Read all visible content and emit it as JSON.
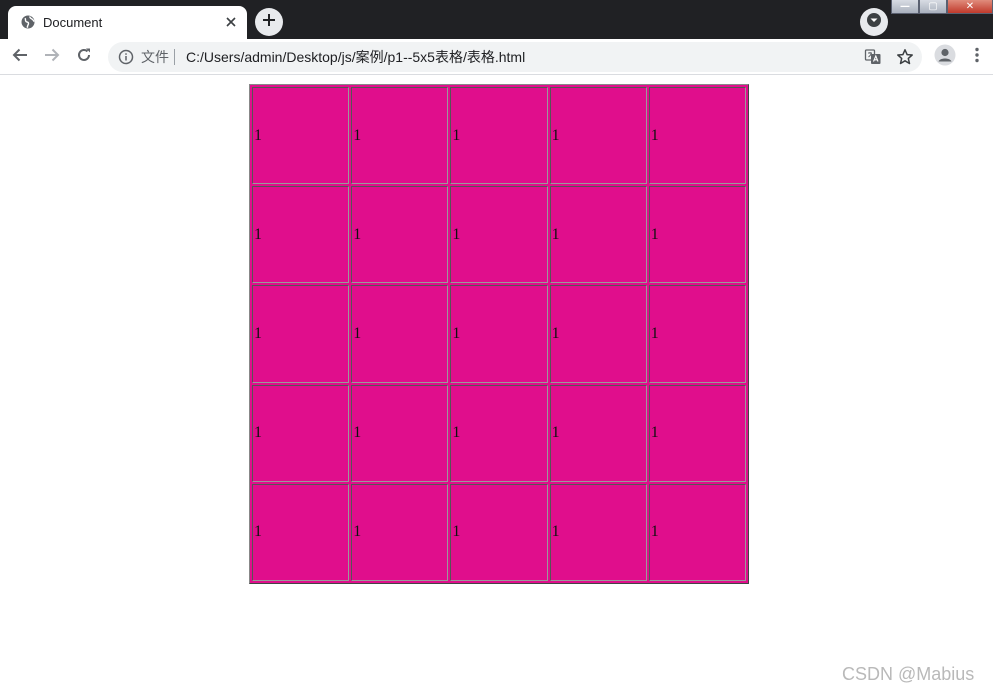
{
  "browser": {
    "tab": {
      "title": "Document",
      "favicon": "globe-icon",
      "close": "close-icon"
    },
    "new_tab": "plus-icon",
    "tab_search": "chevron-down-icon",
    "window_controls": {
      "minimize": "—",
      "maximize": "▢",
      "close": "✕"
    },
    "toolbar": {
      "back": "arrow-left-icon",
      "forward": "arrow-right-icon",
      "reload": "reload-icon",
      "omnibox": {
        "security_label": "文件",
        "url": "C:/Users/admin/Desktop/js/案例/p1--5x5表格/表格.html"
      },
      "translate": "translate-icon",
      "bookmark": "star-icon",
      "profile": "avatar-icon",
      "menu": "kebab-menu-icon"
    }
  },
  "page": {
    "table": {
      "rows": [
        [
          "1",
          "1",
          "1",
          "1",
          "1"
        ],
        [
          "1",
          "1",
          "1",
          "1",
          "1"
        ],
        [
          "1",
          "1",
          "1",
          "1",
          "1"
        ],
        [
          "1",
          "1",
          "1",
          "1",
          "1"
        ],
        [
          "1",
          "1",
          "1",
          "1",
          "1"
        ]
      ]
    }
  },
  "watermark": "CSDN @Mabius",
  "colors": {
    "cell_background": "#e00e8c",
    "titlebar": "#202124",
    "omnibox": "#f1f3f4"
  }
}
